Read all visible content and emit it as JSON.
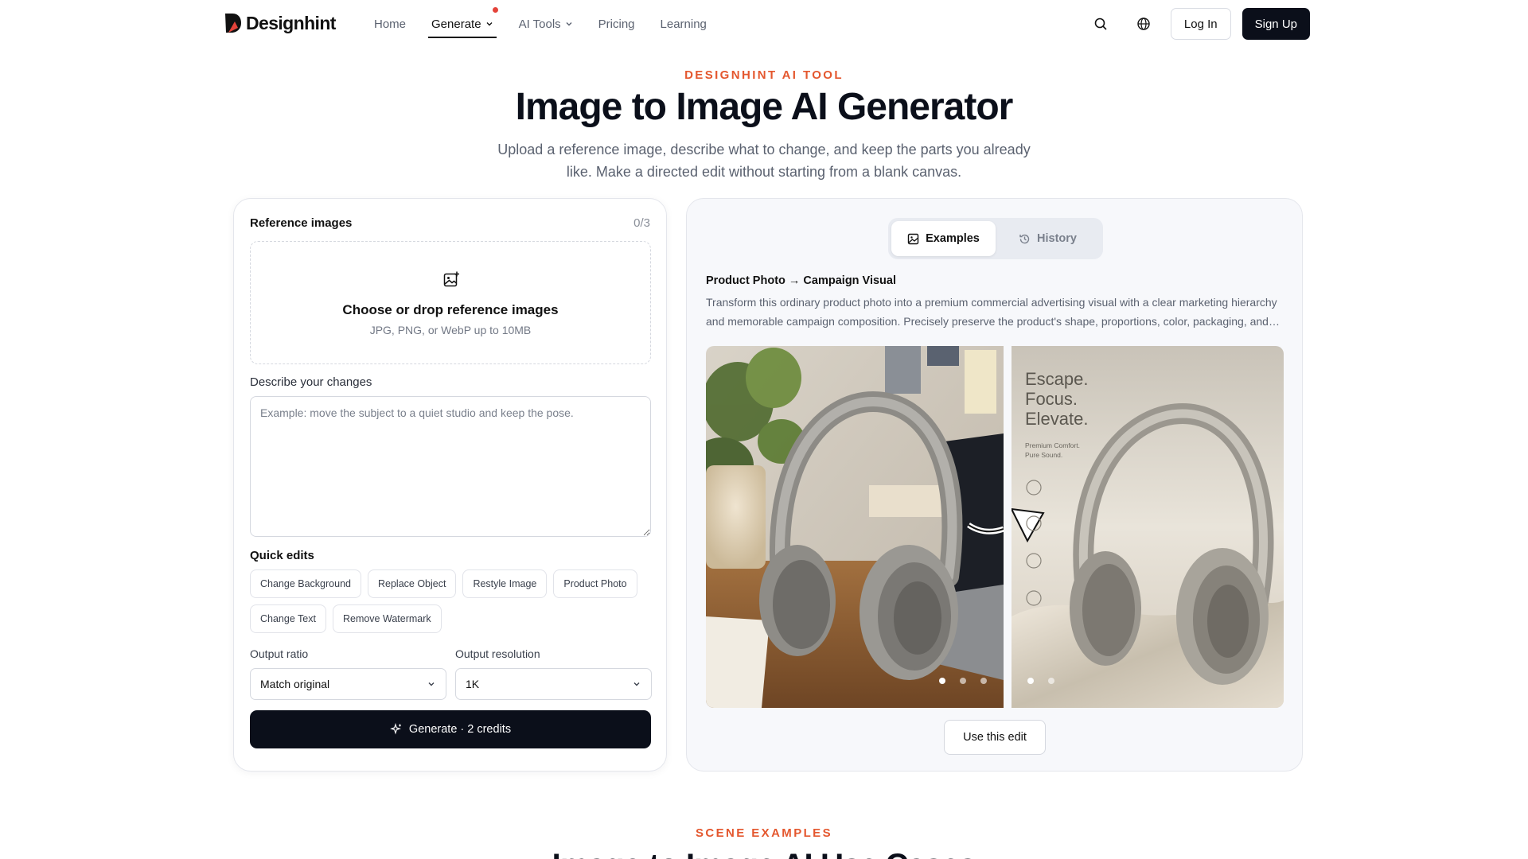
{
  "brand": {
    "name": "Designhint"
  },
  "nav": {
    "links": [
      {
        "label": "Home"
      },
      {
        "label": "Generate"
      },
      {
        "label": "AI Tools"
      },
      {
        "label": "Pricing"
      },
      {
        "label": "Learning"
      }
    ],
    "login_label": "Log In",
    "signup_label": "Sign Up"
  },
  "hero": {
    "eyebrow": "DESIGNHINT AI TOOL",
    "title": "Image to Image AI Generator",
    "subtitle": "Upload a reference image, describe what to change, and keep the parts you already like. Make a directed edit without starting from a blank canvas."
  },
  "form": {
    "reference_label": "Reference images",
    "reference_count": "0/3",
    "dropzone_title": "Choose or drop reference images",
    "dropzone_sub": "JPG, PNG, or WebP up to 10MB",
    "describe_label": "Describe your changes",
    "describe_placeholder": "Example: move the subject to a quiet studio and keep the pose.",
    "quick_edits_label": "Quick edits",
    "quick_edits": [
      "Change Background",
      "Replace Object",
      "Restyle Image",
      "Product Photo",
      "Change Text",
      "Remove Watermark"
    ],
    "ratio_label": "Output ratio",
    "ratio_value": "Match original",
    "resolution_label": "Output resolution",
    "resolution_value": "1K",
    "generate_label": "Generate · 2 credits"
  },
  "preview": {
    "tabs": [
      {
        "label": "Examples"
      },
      {
        "label": "History"
      }
    ],
    "example_title": "Product Photo → Campaign Visual",
    "example_desc": "Transform this ordinary product photo into a premium commercial advertising visual with a clear marketing hierarchy and memorable campaign composition. Precisely preserve the product's shape, proportions, color, packaging, and…",
    "image_after_text": {
      "headline_1": "Escape.",
      "headline_2": "Focus.",
      "headline_3": "Elevate.",
      "tagline_1": "Premium Comfort.",
      "tagline_2": "Pure Sound."
    },
    "use_label": "Use this edit"
  },
  "section": {
    "eyebrow": "SCENE EXAMPLES",
    "title": "Image to Image AI Use Cases"
  },
  "colors": {
    "accent": "#e4572e",
    "primary": "#0b0f1a",
    "badge": "#e4433a"
  }
}
